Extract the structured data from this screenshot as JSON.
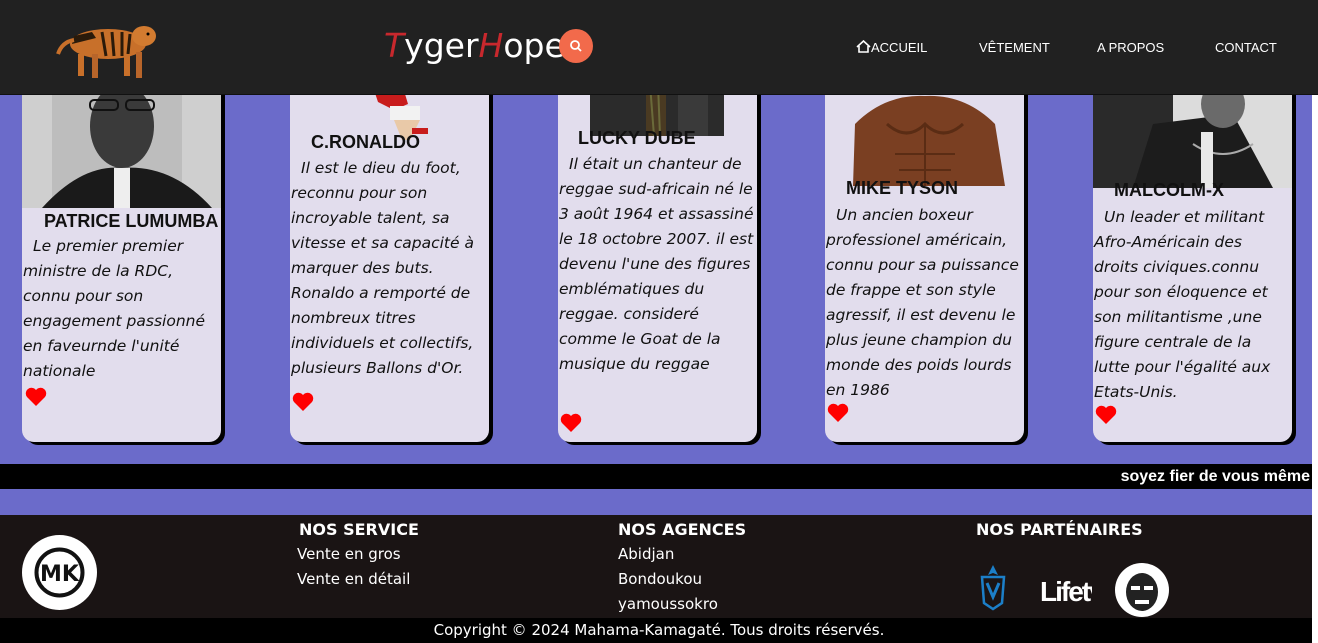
{
  "header": {
    "brand_t": "T",
    "brand_yger": "yger",
    "brand_h": "H",
    "brand_ope": "ope",
    "nav": {
      "home": "ACCUEIL",
      "clothing": "VÊTEMENT",
      "about": "A PROPOS",
      "contact": "CONTACT"
    }
  },
  "cards": [
    {
      "name": "PATRICE LUMUMBA",
      "text": "Le premier premier ministre de la RDC, connu pour son engagement passionné en faveurnde l'unité nationale"
    },
    {
      "name": "C.RONALDO",
      "text": "Il est le dieu du foot, reconnu pour son incroyable talent, sa vitesse et sa capacité à marquer des buts. Ronaldo a remporté de nombreux titres individuels et collectifs, plusieurs Ballons d'Or."
    },
    {
      "name": "LUCKY DUBE",
      "text": "Il était un chanteur de reggae sud-africain né le 3 août 1964 et assassiné le 18 octobre 2007. il est devenu l'une des figures emblématiques du reggae. consideré comme le Goat de la musique du reggae"
    },
    {
      "name": "MIKE TYSON",
      "text": "Un ancien boxeur professionel américain, connu pour sa puissance de frappe et son style agressif, il est devenu le plus jeune champion du monde des poids lourds en 1986"
    },
    {
      "name": "MALCOLM-X",
      "text": "Un leader et militant Afro-Américain des droits civiques.connu pour son éloquence et son militantisme ,une figure centrale de la lutte pour l'égalité aux Etats-Unis."
    }
  ],
  "marquee": "soyez fier de vous même",
  "footer": {
    "services_title": "NOS SERVICE",
    "services": [
      "Vente en gros",
      "Vente en détail"
    ],
    "agencies_title": "NOS AGENCES",
    "agencies": [
      "Abidjan",
      "Bondoukou",
      "yamoussokro"
    ],
    "partners_title": "NOS PARTÉNAIRES",
    "copyright": "Copyright © 2024 Mahama-Kamagaté. Tous droits réservés.",
    "partner_lifetv": "Lifetv",
    "logo_text": "MK"
  },
  "colors": {
    "background": "#6b6bca",
    "header": "#212121",
    "accent_red": "#c8282d",
    "search": "#f26a4b",
    "heart": "#ff0000"
  }
}
